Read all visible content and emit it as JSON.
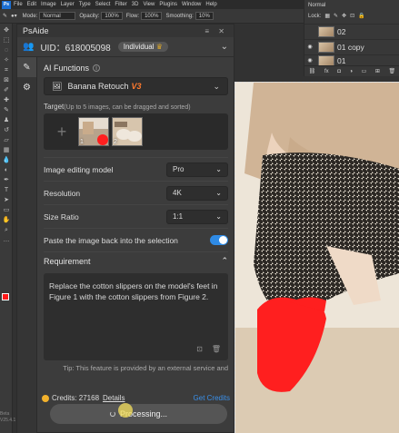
{
  "photoshop": {
    "logo": "Ps",
    "menu": [
      "File",
      "Edit",
      "Image",
      "Layer",
      "Type",
      "Select",
      "Filter",
      "3D",
      "View",
      "Plugins",
      "Window",
      "Help"
    ],
    "options": {
      "mode_label": "Mode:",
      "mode_value": "Normal",
      "opacity_label": "Opacity:",
      "opacity_value": "100%",
      "flow_label": "Flow:",
      "flow_value": "100%",
      "smoothing_label": "Smoothing:",
      "smoothing_value": "10%"
    },
    "version": "Beta V25.4.1",
    "colors": {
      "foreground": "#ff1a1a",
      "background": "#ffffff"
    }
  },
  "layers": {
    "blend": "Normal",
    "lock_label": "Lock:",
    "items": [
      "02",
      "01 copy",
      "01"
    ],
    "bottom_icons": [
      "link-icon",
      "fx-icon",
      "mask-icon",
      "adjustment-icon",
      "folder-icon",
      "new-layer-icon",
      "trash-icon"
    ]
  },
  "plugin": {
    "title": "PsAide",
    "uid": "UID：618005098",
    "plan": "Individual",
    "functions_label": "AI Functions",
    "function_value": "Banana Retouch",
    "function_badge": "V3",
    "target_label": "Target",
    "target_hint": "(Up to 5 images, can be dragged and sorted)",
    "target_images": [
      "1",
      "2"
    ],
    "model_label": "Image editing model",
    "model_value": "Pro",
    "resolution_label": "Resolution",
    "resolution_value": "4K",
    "ratio_label": "Size Ratio",
    "ratio_value": "1:1",
    "paste_label": "Paste the image back into the selection",
    "paste_enabled": true,
    "requirement_label": "Requirement",
    "requirement_text": "Replace the cotton slippers on the model's feet in Figure 1 with the cotton slippers from Figure 2.",
    "tip": "Tip: This feature is provided by an external service and",
    "credits_label": "Credits: 27168",
    "details_label": "Details",
    "get_credits_label": "Get Credits",
    "process_label": "Processing..."
  }
}
